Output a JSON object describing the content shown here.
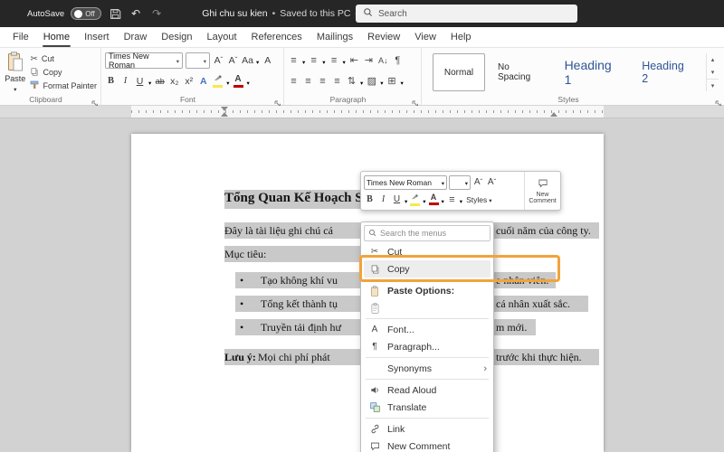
{
  "titlebar": {
    "autosave_label": "AutoSave",
    "autosave_state": "Off",
    "doc_title": "Ghi chu su kien",
    "title_separator": "•",
    "doc_status": "Saved to this PC",
    "search_placeholder": "Search"
  },
  "menubar": {
    "items": [
      "File",
      "Home",
      "Insert",
      "Draw",
      "Design",
      "Layout",
      "References",
      "Mailings",
      "Review",
      "View",
      "Help"
    ],
    "active_item": "Home"
  },
  "ribbon": {
    "clipboard": {
      "group_label": "Clipboard",
      "paste_label": "Paste",
      "cut_label": "Cut",
      "copy_label": "Copy",
      "format_painter_label": "Format Painter"
    },
    "font": {
      "group_label": "Font",
      "font_name": "Times New Roman",
      "bold": "B",
      "italic": "I",
      "underline": "U",
      "strikethrough": "ab",
      "subscript": "x₂",
      "superscript": "x²",
      "change_case": "Aa",
      "grow_shrink_letter": "A",
      "text_effects": "A",
      "font_color": "A"
    },
    "paragraph": {
      "group_label": "Paragraph"
    },
    "styles": {
      "group_label": "Styles",
      "items": [
        "Normal",
        "No Spacing",
        "Heading 1",
        "Heading 2"
      ]
    }
  },
  "document": {
    "heading": "Tổng Quan Kế Hoạch Sự Kiện",
    "para1_left": "Đây là tài liệu ghi chú cá",
    "para1_right": "cuối năm của công ty.",
    "muc_tieu": "Mục tiêu:",
    "bullet_char": "•",
    "bullet1_left": "Tạo không khí vu",
    "bullet1_right": "e nhân viên.",
    "bullet2_left": "Tổng kết thành tụ",
    "bullet2_right": "cá nhân xuất sắc.",
    "bullet3_left": "Truyền tải định hư",
    "bullet3_right": "m mới.",
    "note_lead": "Lưu ý:",
    "note_left": " Mọi chi phí phát",
    "note_right": "trước khi thực hiện."
  },
  "mini_toolbar": {
    "font_name": "Times New Roman",
    "styles_label": "Styles",
    "new_comment_label": "New Comment"
  },
  "context_menu": {
    "search_placeholder": "Search the menus",
    "cut": "Cut",
    "copy": "Copy",
    "paste_options": "Paste Options:",
    "font": "Font...",
    "paragraph": "Paragraph...",
    "synonyms": "Synonyms",
    "read_aloud": "Read Aloud",
    "translate": "Translate",
    "link": "Link",
    "new_comment": "New Comment"
  },
  "colors": {
    "annotation_highlight": "#F2A33C",
    "selection_gray": "#c9c9c9",
    "heading_style_blue": "#2F5496",
    "titlebar_bg": "#262626"
  }
}
